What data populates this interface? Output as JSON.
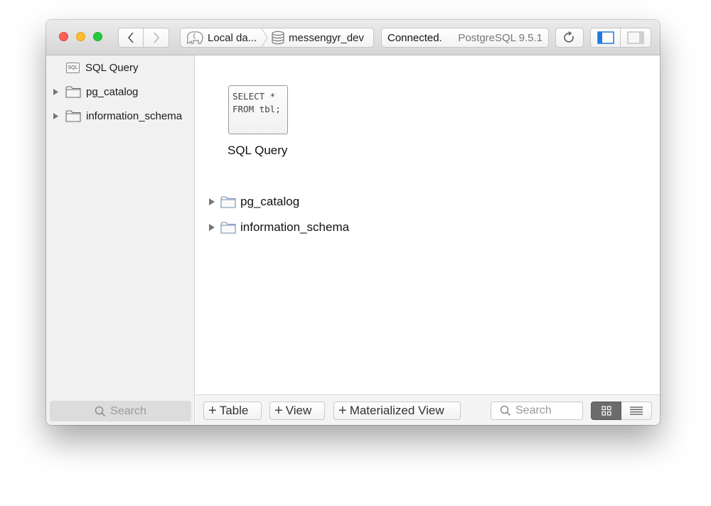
{
  "toolbar": {
    "breadcrumb": [
      {
        "label": "Local da...",
        "icon": "elephant-icon"
      },
      {
        "label": "messengyr_dev",
        "icon": "database-icon"
      }
    ],
    "status": {
      "connection": "Connected.",
      "server": "PostgreSQL 9.5.1"
    }
  },
  "sidebar": {
    "items": [
      {
        "label": "SQL Query",
        "icon": "sql-file-icon",
        "icon_text": "SQL"
      },
      {
        "label": "pg_catalog",
        "icon": "folder-icon"
      },
      {
        "label": "information_schema",
        "icon": "folder-icon"
      }
    ],
    "search_placeholder": "Search"
  },
  "main": {
    "query_card": {
      "code": "SELECT *\nFROM tbl;",
      "label": "SQL Query"
    },
    "schemas": [
      {
        "label": "pg_catalog"
      },
      {
        "label": "information_schema"
      }
    ]
  },
  "bottombar": {
    "add_table": "Table",
    "add_view": "View",
    "add_materialized_view": "Materialized View",
    "search_placeholder": "Search",
    "view_mode": "grid"
  }
}
